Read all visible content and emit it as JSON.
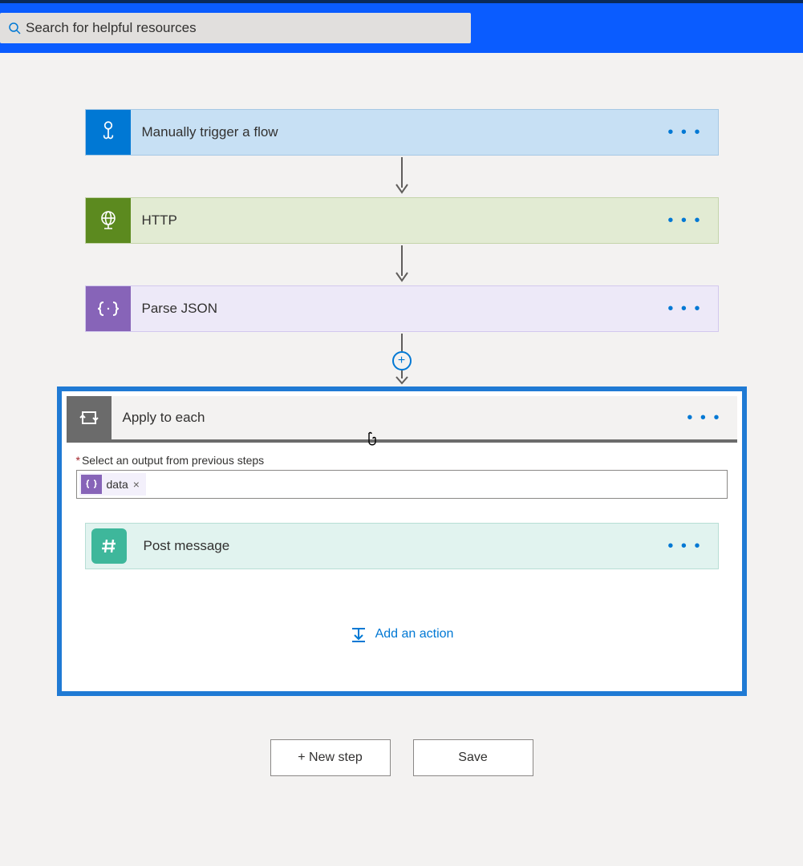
{
  "search": {
    "placeholder": "Search for helpful resources"
  },
  "steps": {
    "trigger": {
      "label": "Manually trigger a flow"
    },
    "http": {
      "label": "HTTP"
    },
    "parse": {
      "label": "Parse JSON"
    },
    "apply": {
      "label": "Apply to each",
      "field_label": "Select an output from previous steps",
      "token": {
        "label": "data",
        "remove": "×"
      }
    },
    "post": {
      "label": "Post message"
    }
  },
  "actions": {
    "add_action": "Add an action",
    "new_step": "+ New step",
    "save": "Save"
  },
  "menu_glyph": "• • •"
}
